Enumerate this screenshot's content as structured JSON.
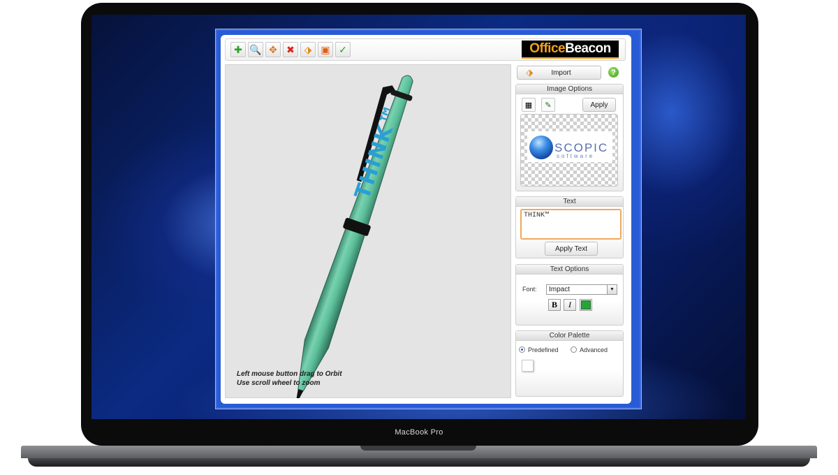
{
  "device": {
    "label": "MacBook Pro"
  },
  "toolbar": {
    "buttons": [
      {
        "name": "add-model",
        "icon": "green-cross-icon",
        "glyph": "✚",
        "color": "#2f9e2a"
      },
      {
        "name": "zoom",
        "icon": "magnifier-icon",
        "glyph": "🔍",
        "color": "#2b8f2b"
      },
      {
        "name": "move",
        "icon": "move-arrows-icon",
        "glyph": "✥",
        "color": "#e0741a"
      },
      {
        "name": "delete",
        "icon": "red-x-icon",
        "glyph": "✖",
        "color": "#d8261b"
      },
      {
        "name": "import-image",
        "icon": "image-import-icon",
        "glyph": "⬗",
        "color": "#e08a1a"
      },
      {
        "name": "screenshot",
        "icon": "camera-icon",
        "glyph": "▣",
        "color": "#e25d14"
      },
      {
        "name": "confirm",
        "icon": "green-check-icon",
        "glyph": "✓",
        "color": "#2e9b23"
      }
    ],
    "logo": {
      "part1": "Office",
      "part2": "Beacon"
    }
  },
  "viewport": {
    "hint_line1": "Left mouse button drag to Orbit",
    "hint_line2": "Use scroll wheel to zoom",
    "pen_text": "THINK™",
    "pen_color": "#5fbf9c",
    "pen_text_color": "#2a9fd4"
  },
  "import": {
    "label": "Import",
    "help": "?"
  },
  "image_options": {
    "title": "Image Options",
    "apply_label": "Apply",
    "preview_brand": "SCOPIC",
    "preview_sub": "software"
  },
  "text_panel": {
    "title": "Text",
    "value": "THINK™",
    "apply_label": "Apply Text"
  },
  "text_options": {
    "title": "Text Options",
    "font_label": "Font:",
    "font_value": "Impact",
    "bold": "B",
    "italic": "I",
    "text_color": "#27a33a"
  },
  "color_palette": {
    "title": "Color Palette",
    "option_predefined": "Predefined",
    "option_advanced": "Advanced",
    "selected": "Predefined"
  }
}
